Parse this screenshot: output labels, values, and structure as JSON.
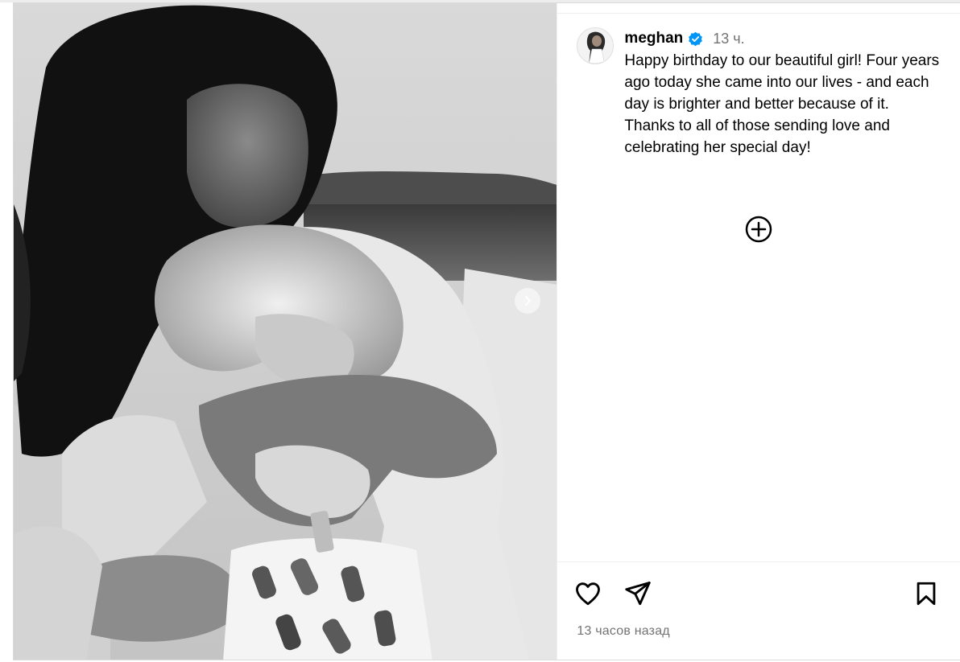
{
  "post": {
    "username": "meghan",
    "verified_icon": "verified-badge-icon",
    "time_ago": "13 ч.",
    "caption": "Happy birthday to our beautiful girl! Four years ago today she came into our lives - and each day is brighter and better because of it. Thanks to all of those sending love and celebrating her special day!",
    "timestamp": "13 часов назад"
  },
  "colors": {
    "verified_blue": "#0095f6",
    "secondary_text": "#737373",
    "divider": "#efefef"
  },
  "icons": {
    "next": "chevron-right-icon",
    "more": "plus-circle-icon",
    "like": "heart-icon",
    "share": "paper-plane-icon",
    "save": "bookmark-icon"
  }
}
